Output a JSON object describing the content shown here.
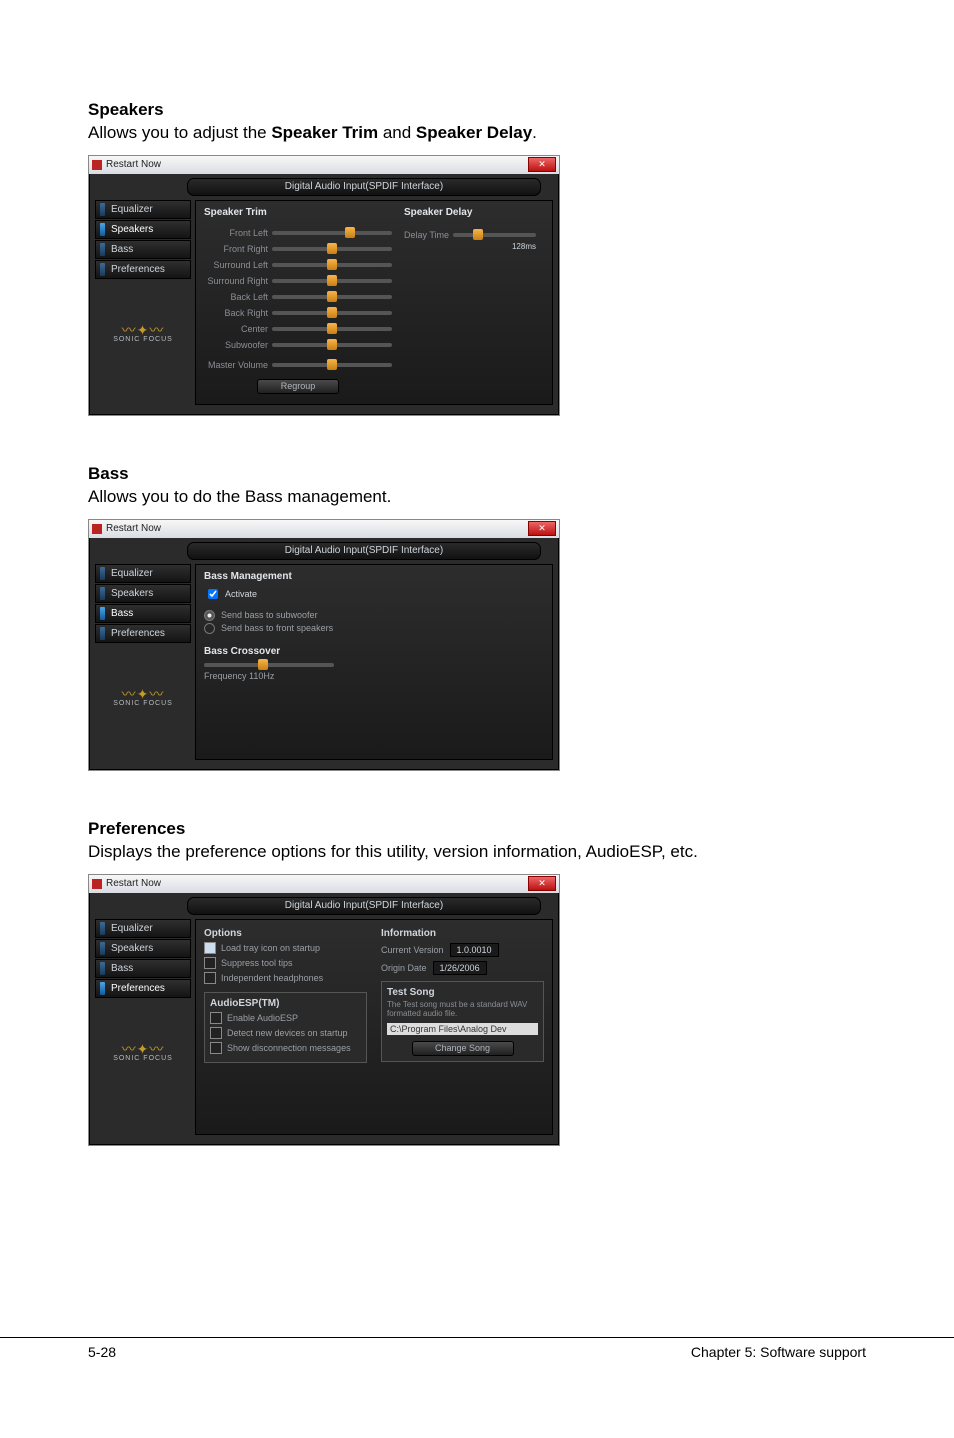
{
  "doc": {
    "speakers": {
      "heading": "Speakers",
      "desc_pre": "Allows you to adjust the ",
      "desc_b1": "Speaker Trim",
      "desc_mid": " and ",
      "desc_b2": "Speaker Delay",
      "desc_post": "."
    },
    "bass": {
      "heading": "Bass",
      "desc": "Allows you to do the Bass management."
    },
    "prefs": {
      "heading": "Preferences",
      "desc": "Displays the preference options for this utility, version information, AudioESP, etc."
    },
    "footer_left": "5-28",
    "footer_right": "Chapter 5: Software support"
  },
  "win": {
    "title": "Restart Now",
    "close_glyph": "✕",
    "banner": "Digital Audio Input(SPDIF Interface)",
    "tabs": {
      "equalizer": "Equalizer",
      "speakers": "Speakers",
      "bass": "Bass",
      "preferences": "Preferences"
    },
    "logo": "SONIC FOCUS",
    "logo_wing": "〰✦〰"
  },
  "speakers_panel": {
    "col_trim": "Speaker Trim",
    "col_delay": "Speaker Delay",
    "sliders": {
      "front_left": "Front Left",
      "front_right": "Front Right",
      "surround_left": "Surround Left",
      "surround_right": "Surround Right",
      "back_left": "Back Left",
      "back_right": "Back Right",
      "center": "Center",
      "subwoofer": "Subwoofer",
      "master": "Master Volume"
    },
    "delay_label": "Delay Time",
    "delay_unit": "128ms",
    "regroup": "Regroup"
  },
  "bass_panel": {
    "title": "Bass Management",
    "activate": "Activate",
    "radio1": "Send bass to subwoofer",
    "radio2": "Send bass to front speakers",
    "cross_title": "Bass Crossover",
    "freq": "Frequency   110Hz"
  },
  "prefs_panel": {
    "options_title": "Options",
    "opt1": "Load tray icon on startup",
    "opt2": "Suppress tool tips",
    "opt3": "Independent headphones",
    "audioesp_title": "AudioESP(TM)",
    "esp1": "Enable AudioESP",
    "esp2": "Detect new devices on startup",
    "esp3": "Show disconnection messages",
    "info_title": "Information",
    "ver_label": "Current Version",
    "ver_value": "1.0.0010",
    "date_label": "Origin Date",
    "date_value": "1/26/2006",
    "test_title": "Test Song",
    "test_desc": "The Test song must be a standard WAV formatted audio file.",
    "test_path": "C:\\Program Files\\Analog Dev",
    "change_song": "Change Song"
  }
}
